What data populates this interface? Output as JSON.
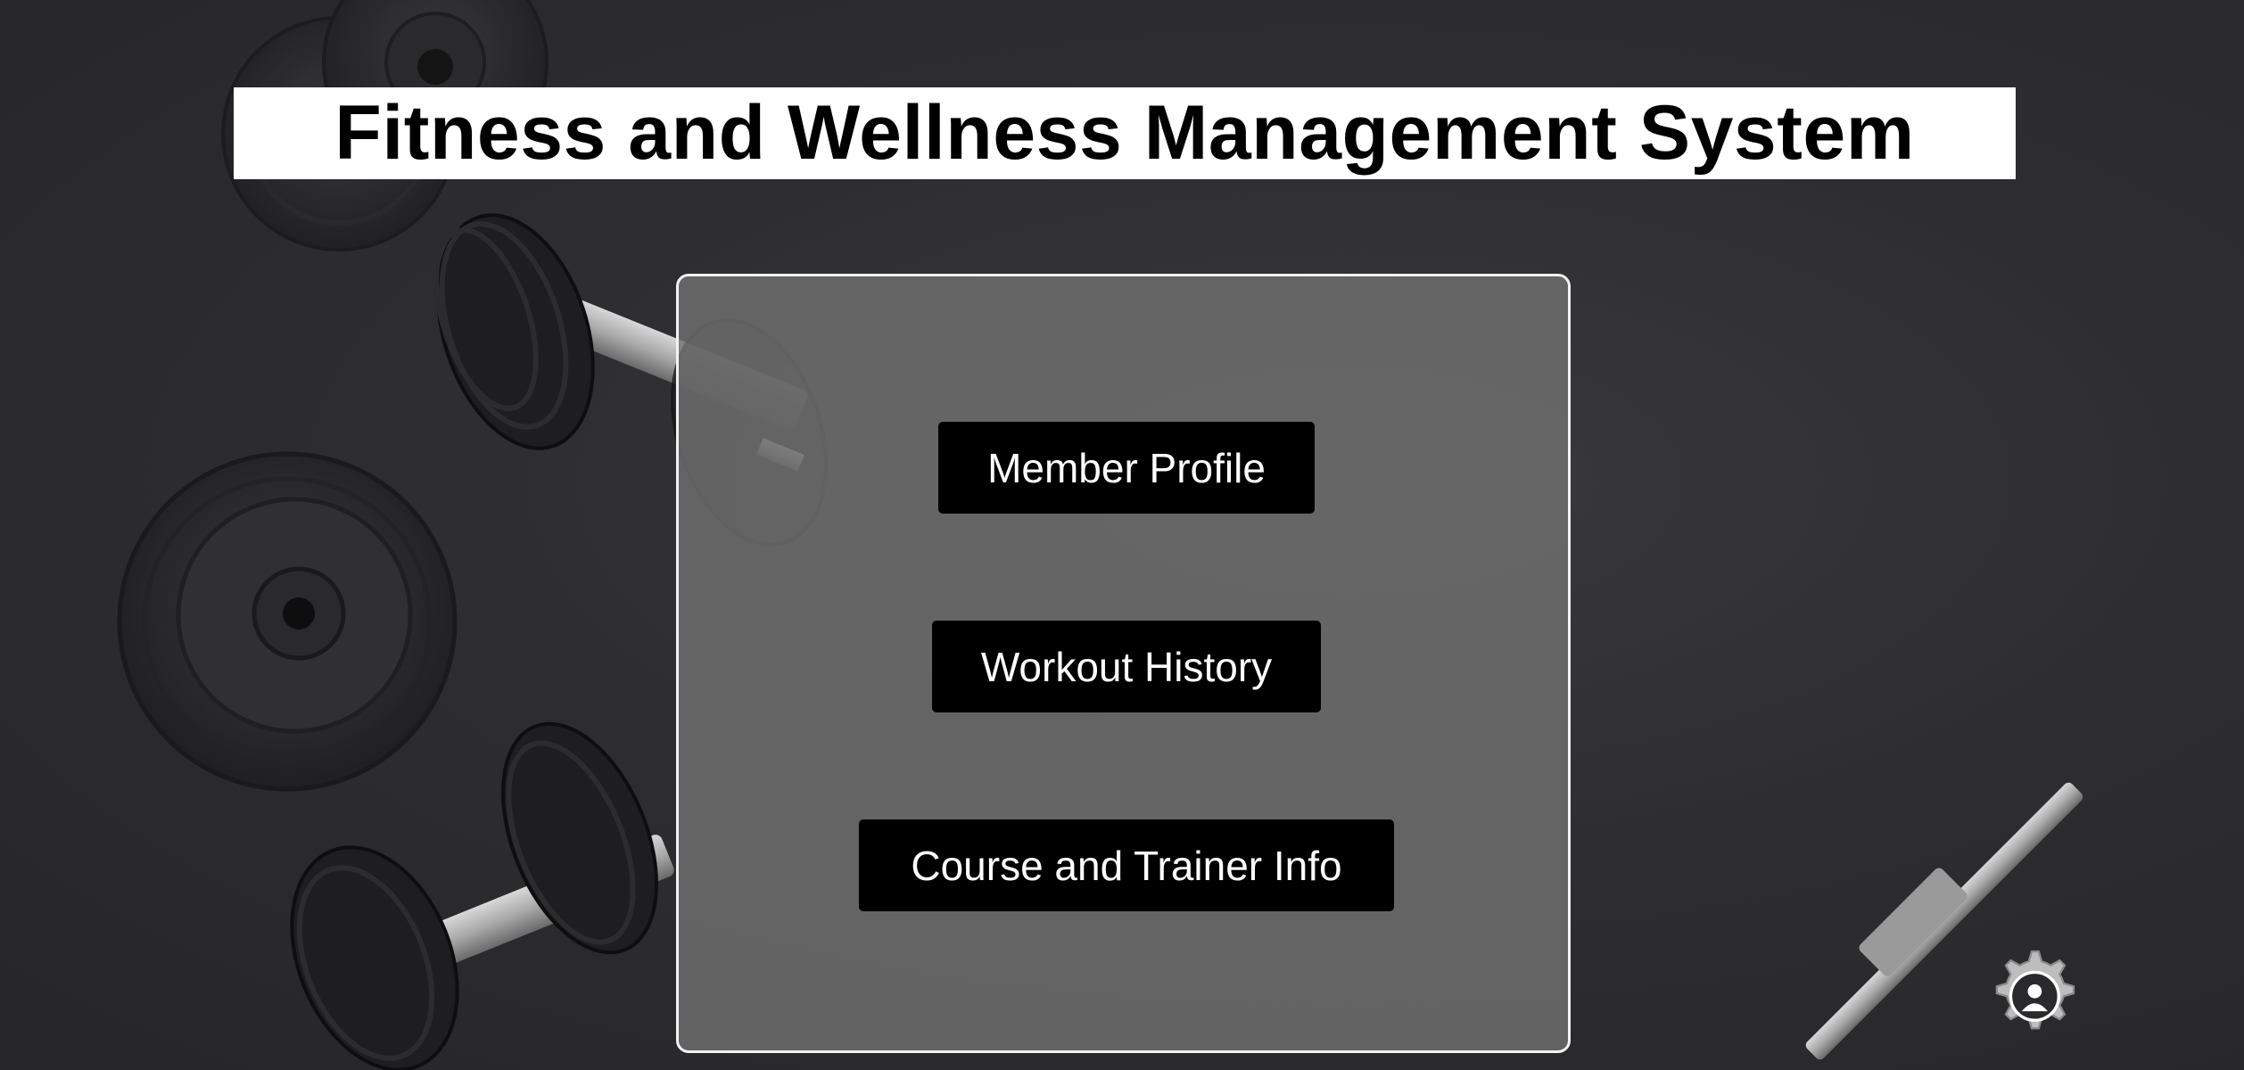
{
  "app": {
    "title": "Fitness and Wellness Management System"
  },
  "menu": {
    "buttons": [
      {
        "label": "Member Profile"
      },
      {
        "label": "Workout History"
      },
      {
        "label": "Course and Trainer Info"
      }
    ]
  },
  "icons": {
    "settings": "gear-icon"
  },
  "colors": {
    "background": "#2e2e30",
    "title_bg": "#ffffff",
    "title_text": "#000000",
    "panel_bg": "#707070",
    "panel_border": "#f2f2f2",
    "button_bg": "#000000",
    "button_text": "#ffffff"
  }
}
